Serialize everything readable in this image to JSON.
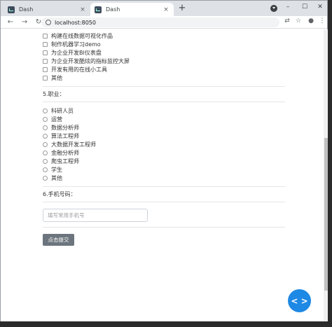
{
  "browser": {
    "tabs": [
      {
        "title": "Dash",
        "close": "×"
      },
      {
        "title": "Dash",
        "close": "×"
      }
    ],
    "new_tab": "+",
    "window_controls": {
      "minimize": "–",
      "maximize": "☐",
      "close": "✕"
    },
    "url": "localhost:8050",
    "nav": {
      "back": "←",
      "forward": "→",
      "reload": "↻"
    },
    "toolbar_icons": {
      "translate": "⇄",
      "star": "☆",
      "menu": "⋮",
      "profile": "●"
    }
  },
  "form": {
    "works_options": [
      "构建在线数据可视化作品",
      "制作机器学习demo",
      "为企业开发BI仪表盘",
      "为企业开发酷炫的指标监控大屏",
      "开发有用的在线小工具",
      "其他"
    ],
    "q5_label": "5.职业：",
    "occupations": [
      "科研人员",
      "运营",
      "数据分析师",
      "算法工程师",
      "大数据开发工程师",
      "金融分析师",
      "爬虫工程师",
      "学生",
      "其他"
    ],
    "q6_label": "6.手机号码：",
    "phone_placeholder": "填写常用手机号",
    "submit_label": "点击提交"
  },
  "fab": {
    "icon": "code-icon",
    "glyph": "< >"
  },
  "colors": {
    "fab": "#1e88e5",
    "submit": "#6c757d"
  }
}
